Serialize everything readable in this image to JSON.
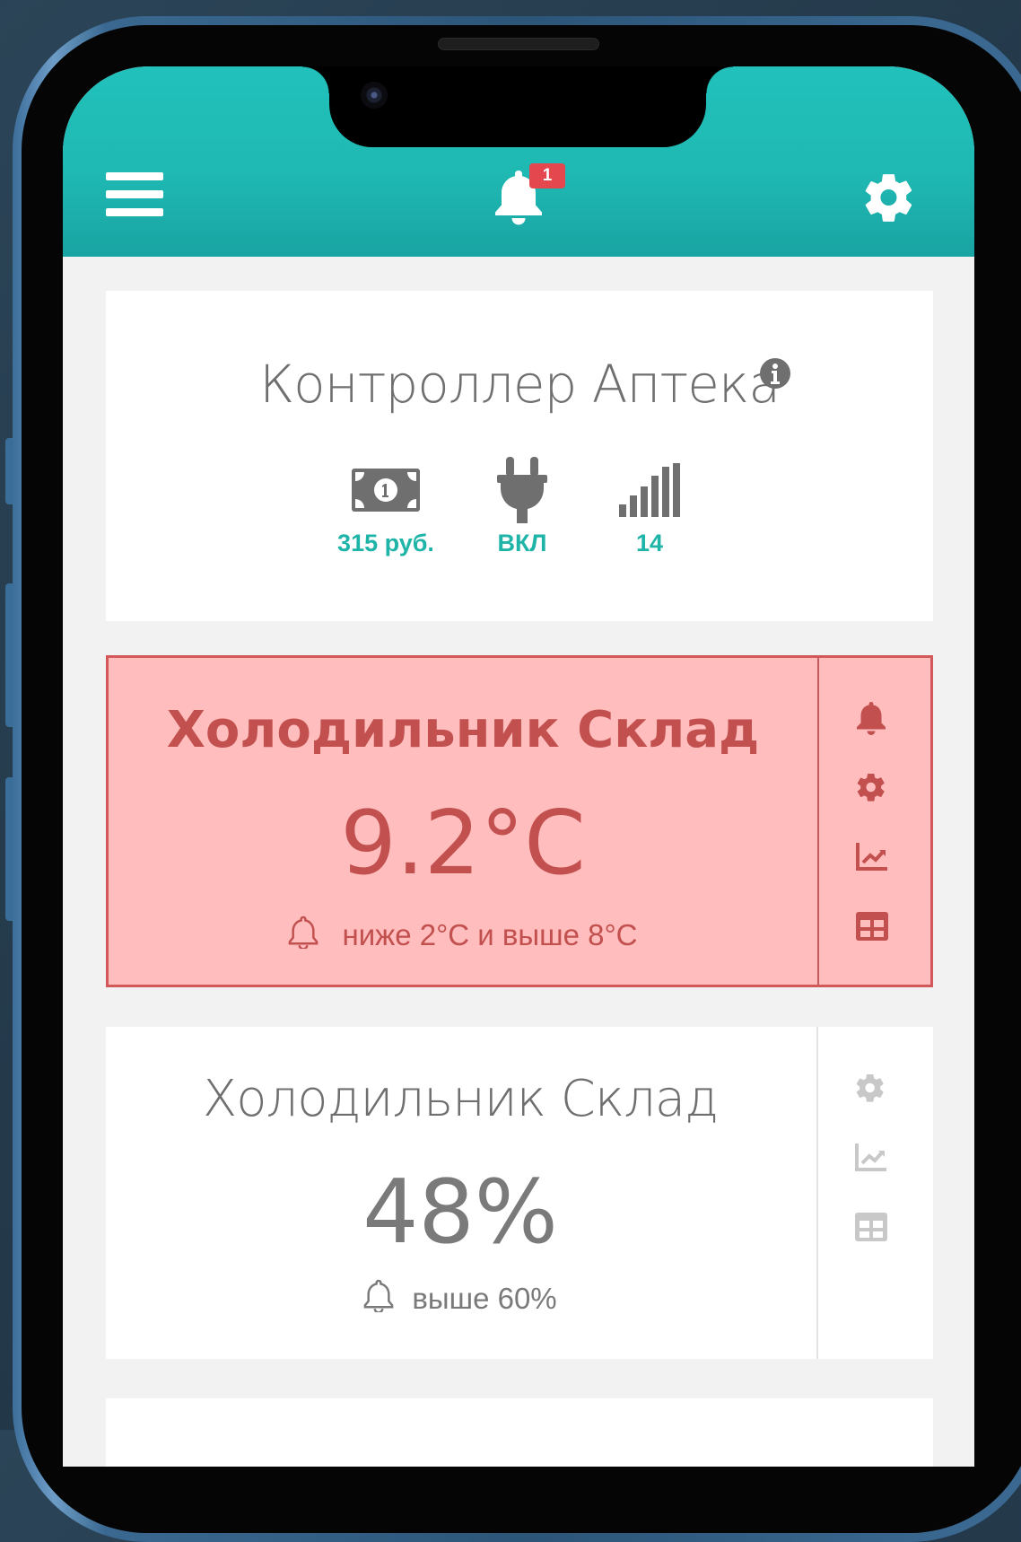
{
  "colors": {
    "header": "#22c1bb",
    "accent": "#1fb4a8",
    "alarm_bg": "#ffbdbd",
    "alarm_text": "#c2504e",
    "badge": "#e5474f"
  },
  "header": {
    "notification_count": "1",
    "menu_icon": "hamburger-icon",
    "bell_icon": "bell-icon",
    "settings_icon": "gear-icon"
  },
  "controller": {
    "title": "Контроллер Аптека",
    "stats": [
      {
        "icon": "money-bill-icon",
        "value": "315 руб."
      },
      {
        "icon": "plug-icon",
        "value": "ВКЛ"
      },
      {
        "icon": "signal-icon",
        "value": "14"
      }
    ]
  },
  "sensors": [
    {
      "title": "Холодильник Склад",
      "value": "9.2°C",
      "threshold": "ниже 2°C и выше 8°C",
      "state": "alarm",
      "actions": [
        "bell-icon",
        "gear-icon",
        "chart-icon",
        "table-icon"
      ]
    },
    {
      "title": "Холодильник Склад",
      "value": "48%",
      "threshold": "выше 60%",
      "state": "normal",
      "actions": [
        "gear-icon",
        "chart-icon",
        "table-icon"
      ]
    }
  ]
}
